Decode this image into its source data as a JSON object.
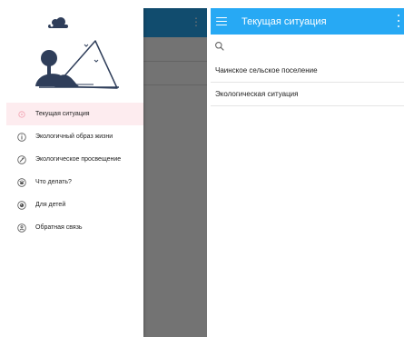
{
  "drawer": {
    "items": [
      {
        "label": "Текущая ситуация",
        "icon": "circle-dot-icon",
        "active": true
      },
      {
        "label": "Экологичный образ жизни",
        "icon": "info-circle-icon",
        "active": false
      },
      {
        "label": "Экологическое просвещение",
        "icon": "satellite-circle-icon",
        "active": false
      },
      {
        "label": "Что делать?",
        "icon": "paw-circle-icon",
        "active": false
      },
      {
        "label": "Для детей",
        "icon": "ball-circle-icon",
        "active": false
      },
      {
        "label": "Обратная связь",
        "icon": "person-circle-icon",
        "active": false
      }
    ]
  },
  "main": {
    "title": "Текущая ситуация",
    "items": [
      {
        "label": "Чаинское сельское поселение"
      },
      {
        "label": "Экологическая ситуация"
      }
    ]
  },
  "colors": {
    "toolbar": "#27a9f4",
    "drawer_active_bg": "#fdecef",
    "illustration_ink": "#2f3e5a"
  }
}
